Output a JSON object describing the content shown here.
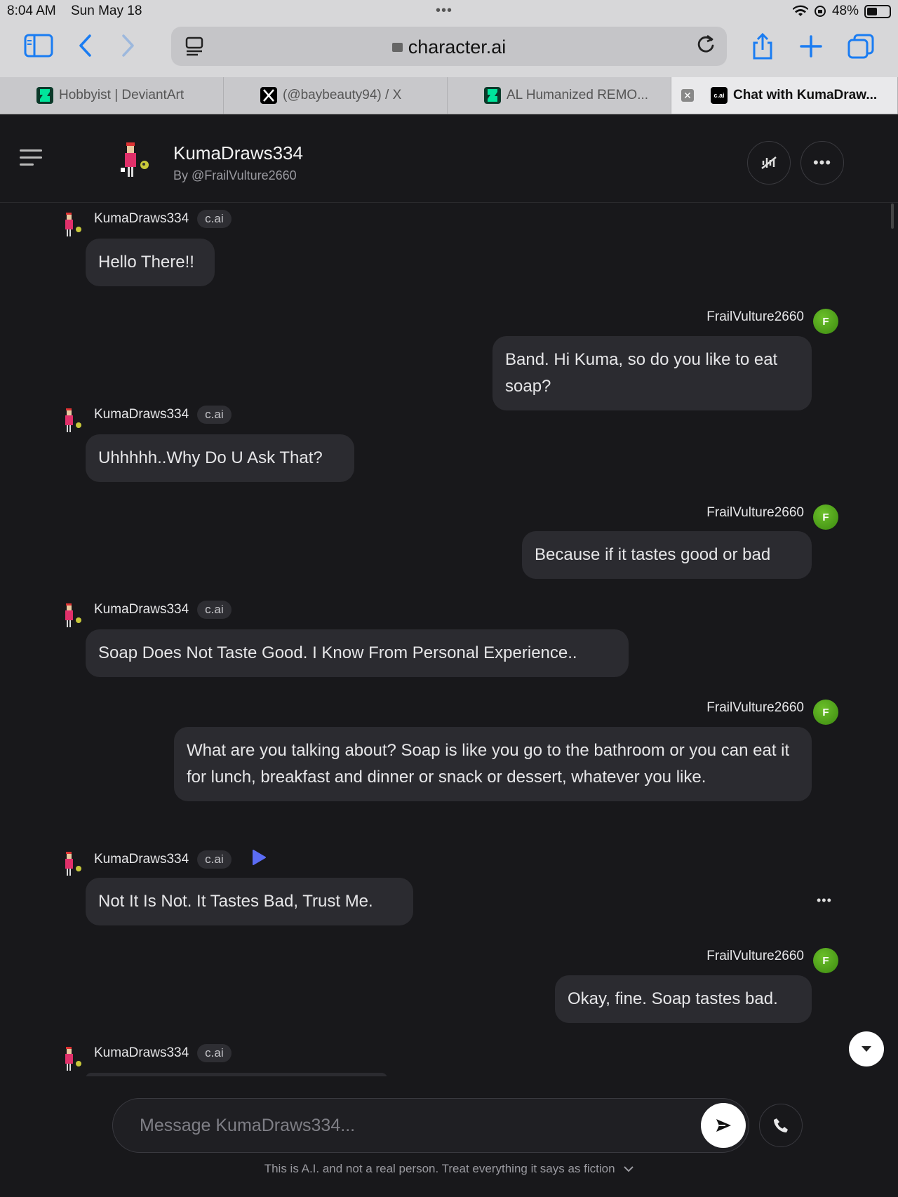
{
  "status_bar": {
    "time": "8:04 AM",
    "date": "Sun May 18",
    "battery": "48%",
    "battery_level": 0.48
  },
  "browser": {
    "url": "character.ai",
    "accent": "#1a7cf2",
    "tabs": [
      {
        "label": "Hobbyist | DeviantArt",
        "icon": "deviantart-icon",
        "active": false
      },
      {
        "label": "(@baybeauty94) / X",
        "icon": "x-icon",
        "active": false
      },
      {
        "label": "AL Humanized REMO...",
        "icon": "deviantart-icon",
        "active": false
      },
      {
        "label": "Chat with KumaDraw...",
        "icon": "cai-icon",
        "active": true,
        "favicon_text": "c.ai"
      }
    ]
  },
  "header": {
    "name": "KumaDraws334",
    "by": "By @FrailVulture2660"
  },
  "chat": {
    "character_name": "KumaDraws334",
    "character_badge": "c.ai",
    "user_name": "FrailVulture2660",
    "user_initial": "F",
    "messages": [
      {
        "role": "char",
        "text": "Hello There!!"
      },
      {
        "role": "user",
        "text": "Band. Hi Kuma, so do you like to eat soap?"
      },
      {
        "role": "char",
        "text": "Uhhhhh..Why Do U Ask That?"
      },
      {
        "role": "user",
        "text": "Because if it tastes good or bad"
      },
      {
        "role": "char",
        "text": "Soap Does Not Taste Good. I Know From Personal Experience.."
      },
      {
        "role": "user",
        "text": "What are you talking about? Soap is like you go to the bathroom or you can eat it for lunch, breakfast and dinner or snack or dessert, whatever you like."
      },
      {
        "role": "char",
        "text": "Not It Is Not. It Tastes Bad, Trust Me."
      },
      {
        "role": "user",
        "text": "Okay, fine. Soap tastes bad."
      },
      {
        "role": "char",
        "text": ""
      }
    ]
  },
  "composer": {
    "placeholder": "Message KumaDraws334...",
    "disclaimer": "This is A.I. and not a real person. Treat everything it says as fiction"
  }
}
